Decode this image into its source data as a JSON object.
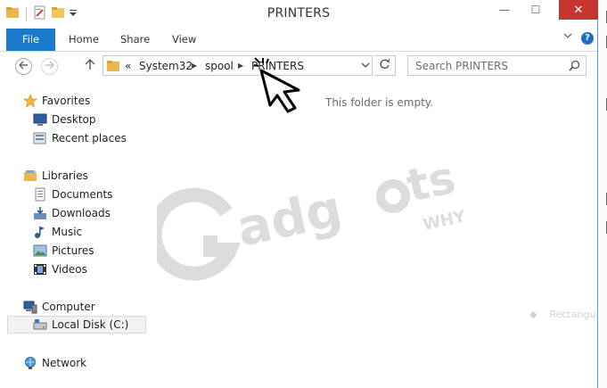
{
  "window": {
    "title": "PRINTERS"
  },
  "title_controls": {
    "minimize": "—",
    "maximize": "☐",
    "close": "✕"
  },
  "ribbon": {
    "tabs": [
      {
        "label": "File"
      },
      {
        "label": "Home"
      },
      {
        "label": "Share"
      },
      {
        "label": "View"
      }
    ],
    "help": "?"
  },
  "address_bar": {
    "overflow": "«",
    "crumbs": [
      "System32",
      "spool",
      "PRINTERS"
    ]
  },
  "search": {
    "placeholder": "Search PRINTERS"
  },
  "nav_pane": {
    "items": [
      {
        "label": "Favorites",
        "icon": "star-icon"
      },
      {
        "label": "Desktop",
        "icon": "desktop-icon"
      },
      {
        "label": "Recent places",
        "icon": "recent-places-icon"
      },
      {
        "label": "Libraries",
        "icon": "libraries-icon"
      },
      {
        "label": "Documents",
        "icon": "documents-icon"
      },
      {
        "label": "Downloads",
        "icon": "downloads-icon"
      },
      {
        "label": "Music",
        "icon": "music-icon"
      },
      {
        "label": "Pictures",
        "icon": "pictures-icon"
      },
      {
        "label": "Videos",
        "icon": "videos-icon"
      },
      {
        "label": "Computer",
        "icon": "computer-icon"
      },
      {
        "label": "Local Disk (C:)",
        "icon": "local-disk-icon",
        "selected": true
      },
      {
        "label": "Network",
        "icon": "network-icon"
      }
    ]
  },
  "content": {
    "empty_message": "This folder is empty."
  },
  "watermark": {
    "brand": "adg",
    "suffix": "ts",
    "tag": "WHY"
  },
  "background_hint": {
    "label": "Rectangul"
  },
  "colors": {
    "accent": "#1979ca",
    "close_button": "#c7342f",
    "watermark": "#dcdcdc"
  }
}
